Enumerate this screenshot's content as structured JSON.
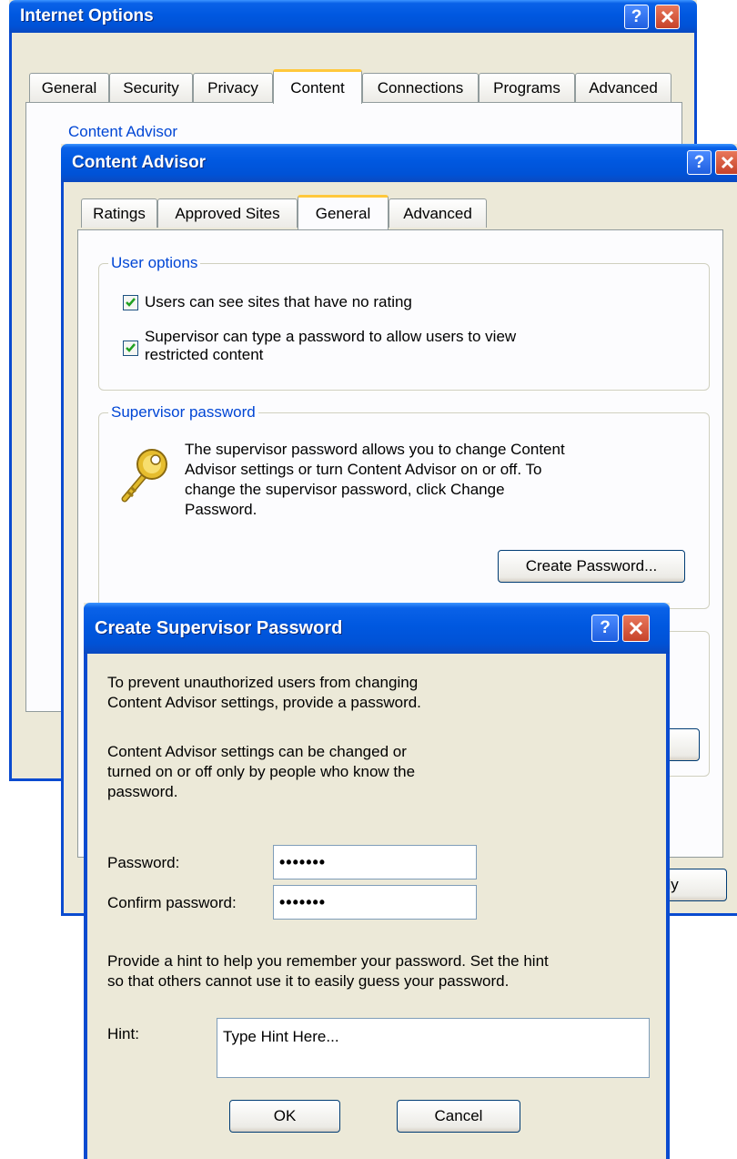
{
  "internet_options": {
    "title": "Internet Options",
    "tabs": [
      "General",
      "Security",
      "Privacy",
      "Content",
      "Connections",
      "Programs",
      "Advanced"
    ],
    "active_tab": "Content",
    "partial_group_label": "Content Advisor"
  },
  "content_advisor": {
    "title": "Content Advisor",
    "tabs": [
      "Ratings",
      "Approved Sites",
      "General",
      "Advanced"
    ],
    "active_tab": "General",
    "user_options": {
      "legend": "User options",
      "option1": {
        "label": "Users can see sites that have no rating",
        "checked": true
      },
      "option2": {
        "label_line1": "Supervisor can type a password to allow users to view",
        "label_line2": "restricted content",
        "checked": true
      }
    },
    "supervisor_password": {
      "legend": "Supervisor password",
      "description_lines": [
        "The supervisor password allows you to change Content",
        "Advisor settings or turn Content Advisor on or off. To",
        "change the supervisor password, click Change",
        "Password."
      ],
      "create_button": "Create Password..."
    },
    "apply_button_partial": "ply"
  },
  "create_password_dialog": {
    "title": "Create Supervisor Password",
    "intro_lines": [
      "To prevent unauthorized users from changing",
      "Content Advisor settings, provide a password."
    ],
    "info_lines": [
      "Content Advisor settings can be changed or",
      "turned on or off only by people who know the",
      "password."
    ],
    "password_label": "Password:",
    "password_value": "•••••••",
    "confirm_label": "Confirm password:",
    "confirm_value": "•••••••",
    "hint_intro_lines": [
      "Provide a hint to help you remember your password. Set the hint",
      "so that others cannot use it to easily guess your password."
    ],
    "hint_label": "Hint:",
    "hint_value": "Type Hint Here...",
    "ok_button": "OK",
    "cancel_button": "Cancel"
  },
  "icons": {
    "help": "help-icon",
    "close": "close-icon",
    "key": "key-icon",
    "check": "checkmark-icon"
  },
  "colors": {
    "titlebar_blue": "#0058e0",
    "dialog_face": "#ece9d8",
    "group_legend": "#0046d5",
    "close_red": "#c6432a",
    "active_tab_highlight": "#ffc83c"
  }
}
